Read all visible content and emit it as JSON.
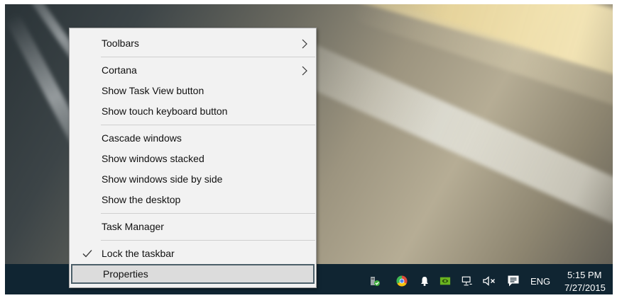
{
  "context_menu": {
    "items": [
      {
        "label": "Toolbars",
        "has_submenu": true
      },
      {
        "label": "Cortana",
        "has_submenu": true
      },
      {
        "label": "Show Task View button"
      },
      {
        "label": "Show touch keyboard button"
      },
      {
        "label": "Cascade windows"
      },
      {
        "label": "Show windows stacked"
      },
      {
        "label": "Show windows side by side"
      },
      {
        "label": "Show the desktop"
      },
      {
        "label": "Task Manager"
      },
      {
        "label": "Lock the taskbar",
        "checked": true
      },
      {
        "label": "Properties",
        "highlighted": true
      }
    ]
  },
  "taskbar": {
    "tray_icons": [
      "usb-device-icon",
      "chrome-icon",
      "notification-bell-icon",
      "nvidia-icon",
      "network-icon",
      "volume-muted-icon",
      "action-center-icon"
    ],
    "language": "ENG",
    "time": "5:15 PM",
    "date": "7/27/2015"
  },
  "colors": {
    "taskbar_bg": "#102532",
    "menu_bg": "#f2f2f2",
    "menu_highlight": "#dcdcdc"
  }
}
